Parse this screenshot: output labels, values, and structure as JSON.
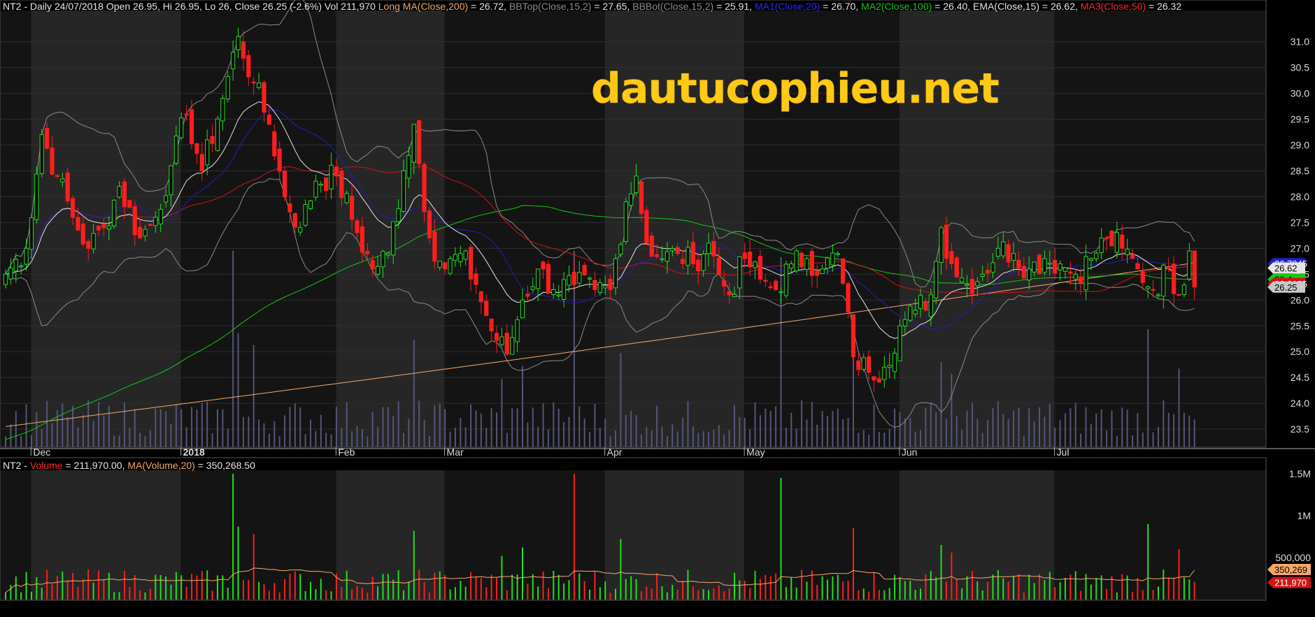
{
  "colors": {
    "background": "#000000",
    "band_dark": "#141414",
    "band_light": "#262626",
    "up": "#20e020",
    "down": "#ff1e1e",
    "ma200": "#f7a869",
    "bb": "#8c8c8c",
    "ma20": "#1f1fc8",
    "ma100": "#16c816",
    "ema15": "#e6e6e6",
    "ma50": "#d21414",
    "volume_bar": "#55557a",
    "watermark": "#ffc915"
  },
  "price_header": {
    "base": "NT2 - Daily 24/07/2018 Open 26.95, Hi 26.95, Lo 26, Close 26.25 (-2.6%) Vol 211,970",
    "items": [
      {
        "label": "Long MA(Close,200)",
        "value": " = 26.72,",
        "color": "#f7a869"
      },
      {
        "label": "BBTop(Close,15,2)",
        "value": " = 27.65,",
        "color": "#8c8c8c"
      },
      {
        "label": "BBBot(Close,15,2)",
        "value": " = 25.91,",
        "color": "#8c8c8c"
      },
      {
        "label": "MA1(Close,20)",
        "value": " = 26.70,",
        "color": "#2a2aff"
      },
      {
        "label": "MA2(Close,100)",
        "value": " = 26.40,",
        "color": "#16c816"
      },
      {
        "label": "EMA(Close,15)",
        "value": " = 26.62,",
        "color": "#e6e6e6"
      },
      {
        "label": "MA3(Close,50)",
        "value": " = 26.32",
        "color": "#ff2a2a"
      }
    ]
  },
  "volume_header": {
    "prefix": "NT2 - ",
    "vol_label": "Volume",
    "vol_value": " = 211,970.00, ",
    "ma_label": "MA(Volume,20)",
    "ma_value": " = 350,268.50"
  },
  "watermark": "dautucophieu.net",
  "chart_data": [
    {
      "type": "candlestick",
      "title": "NT2 - Daily 24/07/2018",
      "ylim": [
        23.15,
        31.55
      ],
      "yticks": [
        "23.5",
        "24.0",
        "24.5",
        "25.0",
        "25.5",
        "26.0",
        "26.5",
        "27.0",
        "27.5",
        "28.0",
        "28.5",
        "29.0",
        "29.5",
        "30.0",
        "30.5",
        "31.0"
      ],
      "x_labels": [
        {
          "label": "Dec",
          "bold": false,
          "i": 6
        },
        {
          "label": "2018",
          "bold": true,
          "i": 35
        },
        {
          "label": "Feb",
          "bold": false,
          "i": 65
        },
        {
          "label": "Mar",
          "bold": false,
          "i": 86
        },
        {
          "label": "Apr",
          "bold": false,
          "i": 117
        },
        {
          "label": "May",
          "bold": false,
          "i": 144
        },
        {
          "label": "Jun",
          "bold": false,
          "i": 174
        },
        {
          "label": "Jul",
          "bold": false,
          "i": 204
        }
      ],
      "right_labels": [
        {
          "text": "26.7045",
          "value": 26.7045,
          "bg": "#1f1fc8",
          "fg": "#ffffff"
        },
        {
          "text": "26.62",
          "value": 26.62,
          "bg": "#e6e6e6",
          "fg": "#000000"
        },
        {
          "text": "26.4",
          "value": 26.4,
          "bg": "#16c816",
          "fg": "#000000"
        },
        {
          "text": "26.3185",
          "value": 26.3185,
          "bg": "#d21414",
          "fg": "#ffffff"
        },
        {
          "text": "26.25",
          "value": 26.25,
          "bg": "#c8c8c8",
          "fg": "#000000"
        }
      ],
      "anchors": [
        {
          "i": 0,
          "c": 26.5
        },
        {
          "i": 4,
          "c": 27.0
        },
        {
          "i": 7,
          "c": 29.2
        },
        {
          "i": 10,
          "c": 28.4
        },
        {
          "i": 13,
          "c": 27.6
        },
        {
          "i": 16,
          "c": 27.0
        },
        {
          "i": 19,
          "c": 27.4
        },
        {
          "i": 22,
          "c": 28.2
        },
        {
          "i": 26,
          "c": 27.2
        },
        {
          "i": 29,
          "c": 27.6
        },
        {
          "i": 32,
          "c": 28.6
        },
        {
          "i": 35,
          "c": 29.6
        },
        {
          "i": 38,
          "c": 28.5
        },
        {
          "i": 42,
          "c": 29.9
        },
        {
          "i": 45,
          "c": 31.1
        },
        {
          "i": 48,
          "c": 30.2
        },
        {
          "i": 51,
          "c": 29.4
        },
        {
          "i": 54,
          "c": 28.0
        },
        {
          "i": 57,
          "c": 27.4
        },
        {
          "i": 60,
          "c": 28.3
        },
        {
          "i": 64,
          "c": 28.4
        },
        {
          "i": 68,
          "c": 27.3
        },
        {
          "i": 71,
          "c": 26.6
        },
        {
          "i": 74,
          "c": 26.9
        },
        {
          "i": 77,
          "c": 28.5
        },
        {
          "i": 79,
          "c": 29.4
        },
        {
          "i": 82,
          "c": 27.2
        },
        {
          "i": 85,
          "c": 26.6
        },
        {
          "i": 88,
          "c": 26.9
        },
        {
          "i": 91,
          "c": 26.3
        },
        {
          "i": 94,
          "c": 25.4
        },
        {
          "i": 97,
          "c": 24.95
        },
        {
          "i": 100,
          "c": 26.0
        },
        {
          "i": 103,
          "c": 26.6
        },
        {
          "i": 106,
          "c": 26.2
        },
        {
          "i": 110,
          "c": 26.3
        },
        {
          "i": 114,
          "c": 26.2
        },
        {
          "i": 117,
          "c": 26.2
        },
        {
          "i": 120,
          "c": 27.9
        },
        {
          "i": 122,
          "c": 28.4
        },
        {
          "i": 124,
          "c": 27.1
        },
        {
          "i": 127,
          "c": 26.8
        },
        {
          "i": 130,
          "c": 26.9
        },
        {
          "i": 133,
          "c": 26.7
        },
        {
          "i": 136,
          "c": 27.1
        },
        {
          "i": 138,
          "c": 26.5
        },
        {
          "i": 140,
          "c": 26.1
        },
        {
          "i": 143,
          "c": 26.8
        },
        {
          "i": 146,
          "c": 26.4
        },
        {
          "i": 149,
          "c": 26.2
        },
        {
          "i": 152,
          "c": 26.7
        },
        {
          "i": 155,
          "c": 26.8
        },
        {
          "i": 158,
          "c": 26.6
        },
        {
          "i": 161,
          "c": 26.9
        },
        {
          "i": 164,
          "c": 24.9
        },
        {
          "i": 167,
          "c": 24.6
        },
        {
          "i": 170,
          "c": 24.7
        },
        {
          "i": 173,
          "c": 25.5
        },
        {
          "i": 176,
          "c": 25.8
        },
        {
          "i": 179,
          "c": 26.1
        },
        {
          "i": 181,
          "c": 27.4
        },
        {
          "i": 183,
          "c": 26.7
        },
        {
          "i": 186,
          "c": 26.3
        },
        {
          "i": 189,
          "c": 26.5
        },
        {
          "i": 192,
          "c": 27.0
        },
        {
          "i": 195,
          "c": 26.9
        },
        {
          "i": 198,
          "c": 26.6
        },
        {
          "i": 201,
          "c": 26.8
        },
        {
          "i": 204,
          "c": 26.7
        },
        {
          "i": 207,
          "c": 26.5
        },
        {
          "i": 210,
          "c": 26.8
        },
        {
          "i": 213,
          "c": 27.2
        },
        {
          "i": 216,
          "c": 27.0
        },
        {
          "i": 219,
          "c": 26.6
        },
        {
          "i": 222,
          "c": 26.2
        },
        {
          "i": 225,
          "c": 26.6
        },
        {
          "i": 227,
          "c": 26.1
        },
        {
          "i": 229,
          "c": 26.95
        },
        {
          "i": 230,
          "c": 26.25
        }
      ],
      "notes": "Daily candles Nov 2017 - 24 Jul 2018, overlays MA200, Bollinger(15,2), MA20, MA100, EMA15, MA50; volume histogram at bottom of price pane"
    },
    {
      "type": "bar",
      "title": "NT2 - Volume",
      "ylim": [
        0,
        1650000
      ],
      "yticks": [
        "500,000",
        "1M",
        "1.5M"
      ],
      "ytick_values": [
        500000,
        1000000,
        1500000
      ],
      "right_labels": [
        {
          "text": "350,269",
          "value": 350269,
          "bg": "#f7a869",
          "fg": "#000000"
        },
        {
          "text": "211,970",
          "value": 211970,
          "bg": "#d21414",
          "fg": "#ffffff"
        }
      ],
      "spikes": [
        {
          "i": 44,
          "v": 1500000
        },
        {
          "i": 45,
          "v": 870000
        },
        {
          "i": 48,
          "v": 780000
        },
        {
          "i": 79,
          "v": 820000
        },
        {
          "i": 96,
          "v": 520000
        },
        {
          "i": 100,
          "v": 620000
        },
        {
          "i": 110,
          "v": 1500000
        },
        {
          "i": 119,
          "v": 720000
        },
        {
          "i": 150,
          "v": 1450000
        },
        {
          "i": 164,
          "v": 850000
        },
        {
          "i": 181,
          "v": 650000
        },
        {
          "i": 183,
          "v": 560000
        },
        {
          "i": 221,
          "v": 900000
        },
        {
          "i": 227,
          "v": 600000
        }
      ]
    }
  ]
}
